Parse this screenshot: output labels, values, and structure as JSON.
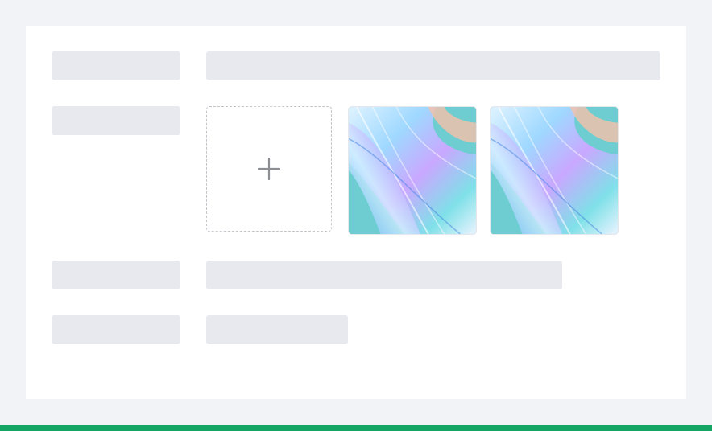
{
  "form": {
    "upload_button": {
      "icon": "plus-icon"
    },
    "thumbnails": [
      {
        "image": "iridescent-abstract-image"
      },
      {
        "image": "iridescent-abstract-image"
      }
    ]
  },
  "colors": {
    "page_background": "#f2f3f7",
    "card_background": "#ffffff",
    "skeleton": "#e7e9ee",
    "upload_border": "#c4c6cc",
    "plus_icon": "#8c8e94",
    "accent_bar": "#14a463"
  }
}
